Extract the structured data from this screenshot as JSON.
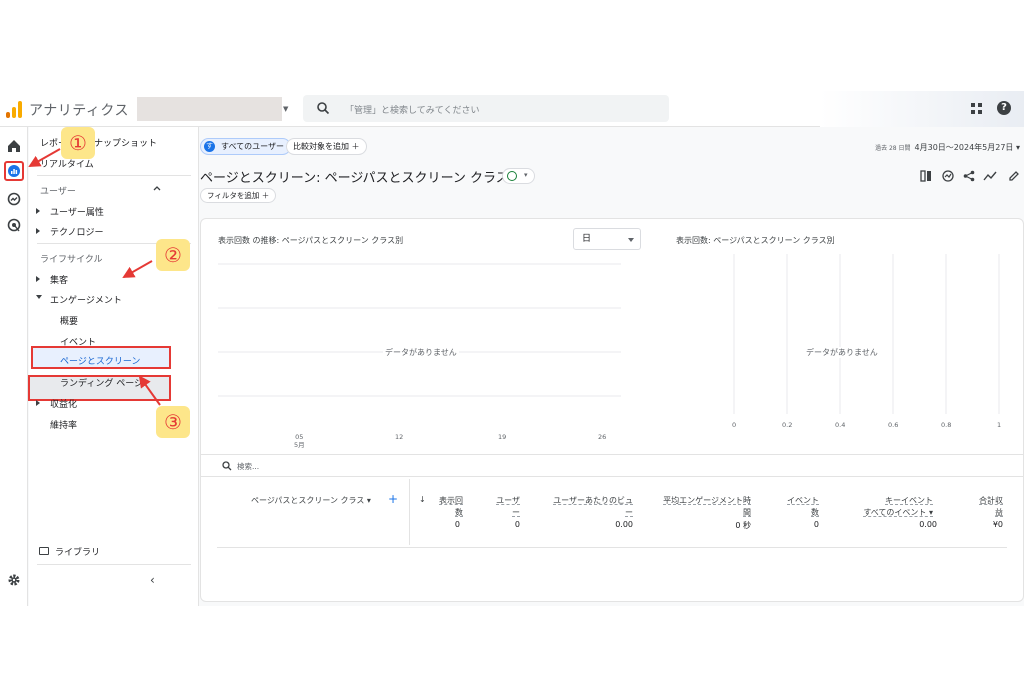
{
  "header": {
    "app_title": "アナリティクス",
    "search_placeholder": "「管理」と検索してみてください"
  },
  "nav": {
    "reports_snapshot": "レポートのスナップショット",
    "realtime": "リアルタイム",
    "user_section": "ユーザー",
    "user_attributes": "ユーザー属性",
    "technology": "テクノロジー",
    "lifecycle_section": "ライフサイクル",
    "acquisition": "集客",
    "engagement": "エンゲージメント",
    "overview": "概要",
    "events": "イベント",
    "pages_and_screens": "ページとスクリーン",
    "landing_page": "ランディング ページ",
    "monetization": "収益化",
    "retention": "維持率",
    "library": "ライブラリ"
  },
  "annotations": {
    "step1": "①",
    "step2": "②",
    "step3": "③"
  },
  "main": {
    "all_users_chip": "すべてのユーザー",
    "all_users_avatar": "す",
    "add_comparison": "比較対象を追加 ＋",
    "date_prefix": "過去 28 日間",
    "date_range": "4月30日～2024年5月27日",
    "page_title": "ページとスクリーン: ページパスとスクリーン クラス",
    "add_filter": "フィルタを追加 ＋"
  },
  "chart_left": {
    "title": "表示回数 の推移: ページパスとスクリーン クラス別",
    "granularity": "日",
    "no_data": "データがありません",
    "x_ticks": [
      "05\n5月",
      "12",
      "19",
      "26"
    ]
  },
  "chart_right": {
    "title": "表示回数: ページパスとスクリーン クラス別",
    "no_data": "データがありません",
    "x_ticks": [
      "0",
      "0.2",
      "0.4",
      "0.6",
      "0.8",
      "1"
    ]
  },
  "table": {
    "search_placeholder": "検索...",
    "dimension_header": "ページパスとスクリーン クラス",
    "columns": [
      {
        "line1": "表示回",
        "line2": "数",
        "total": "0"
      },
      {
        "line1": "ユーザ",
        "line2": "ー",
        "total": "0"
      },
      {
        "line1": "ユーザーあたりのビュ",
        "line2": "ー",
        "total": "0.00"
      },
      {
        "line1": "平均エンゲージメント時",
        "line2": "間",
        "total": "0 秒"
      },
      {
        "line1": "イベント",
        "line2": "数",
        "total": "0"
      },
      {
        "line1": "キーイベント",
        "line2": "すべてのイベント ▾",
        "total": "0.00"
      },
      {
        "line1": "合計収",
        "line2": "益",
        "total": "¥0"
      }
    ]
  },
  "colors": {
    "accent_blue": "#1a73e8",
    "annotation_red": "#e53935",
    "annotation_badge": "#fde68a",
    "logo_orange": "#f9ab00",
    "logo_dark_orange": "#e37400"
  }
}
